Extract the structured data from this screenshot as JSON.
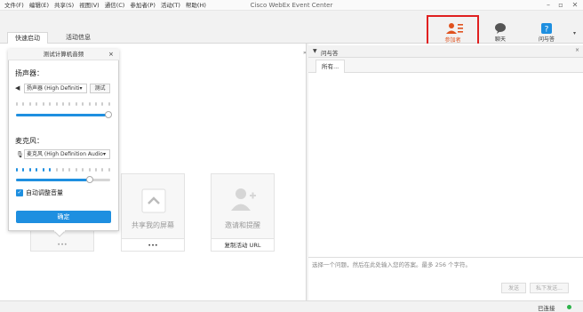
{
  "window": {
    "title": "Cisco WebEx Event Center",
    "menus": [
      "文件(F)",
      "编辑(E)",
      "共享(S)",
      "视图(V)",
      "通信(C)",
      "参加者(P)",
      "活动(T)",
      "帮助(H)"
    ]
  },
  "tabs": {
    "quickstart": "快速启动",
    "event_info": "活动信息"
  },
  "tools": {
    "participants": "参加者",
    "chat": "聊天",
    "qa": "问与答"
  },
  "cards": {
    "share_screen": {
      "title": "共享我的屏幕",
      "footer": "•••"
    },
    "invite": {
      "title": "邀请和提醒",
      "footer": "复制活动 URL"
    },
    "partial_footer": "•••"
  },
  "audio_popup": {
    "title": "测试计算机音频",
    "speaker_label": "扬声器：",
    "speaker_device": "扬声器 (High Definiti▾",
    "test_button": "测试",
    "speaker_volume_fraction": 0.98,
    "mic_label": "麦克风：",
    "mic_device": "麦克风 (High Definition Audio▾",
    "mic_level_active_ticks": 6,
    "mic_volume_fraction": 0.78,
    "auto_adjust_label": "自动调整音量",
    "auto_adjust_checked": true,
    "ok_button": "确定"
  },
  "qa_panel": {
    "header": "问与答",
    "tab_all": "所有...",
    "input_placeholder": "选择一个问题，然后在此处输入您的答案。最多 256 个字符。",
    "send_button": "发送",
    "send_private_button": "私下发送..."
  },
  "status": {
    "connection": "已连接"
  },
  "colors": {
    "accent": "#1e8fe0",
    "highlight": "#e02020",
    "participants_icon": "#e0521f"
  }
}
